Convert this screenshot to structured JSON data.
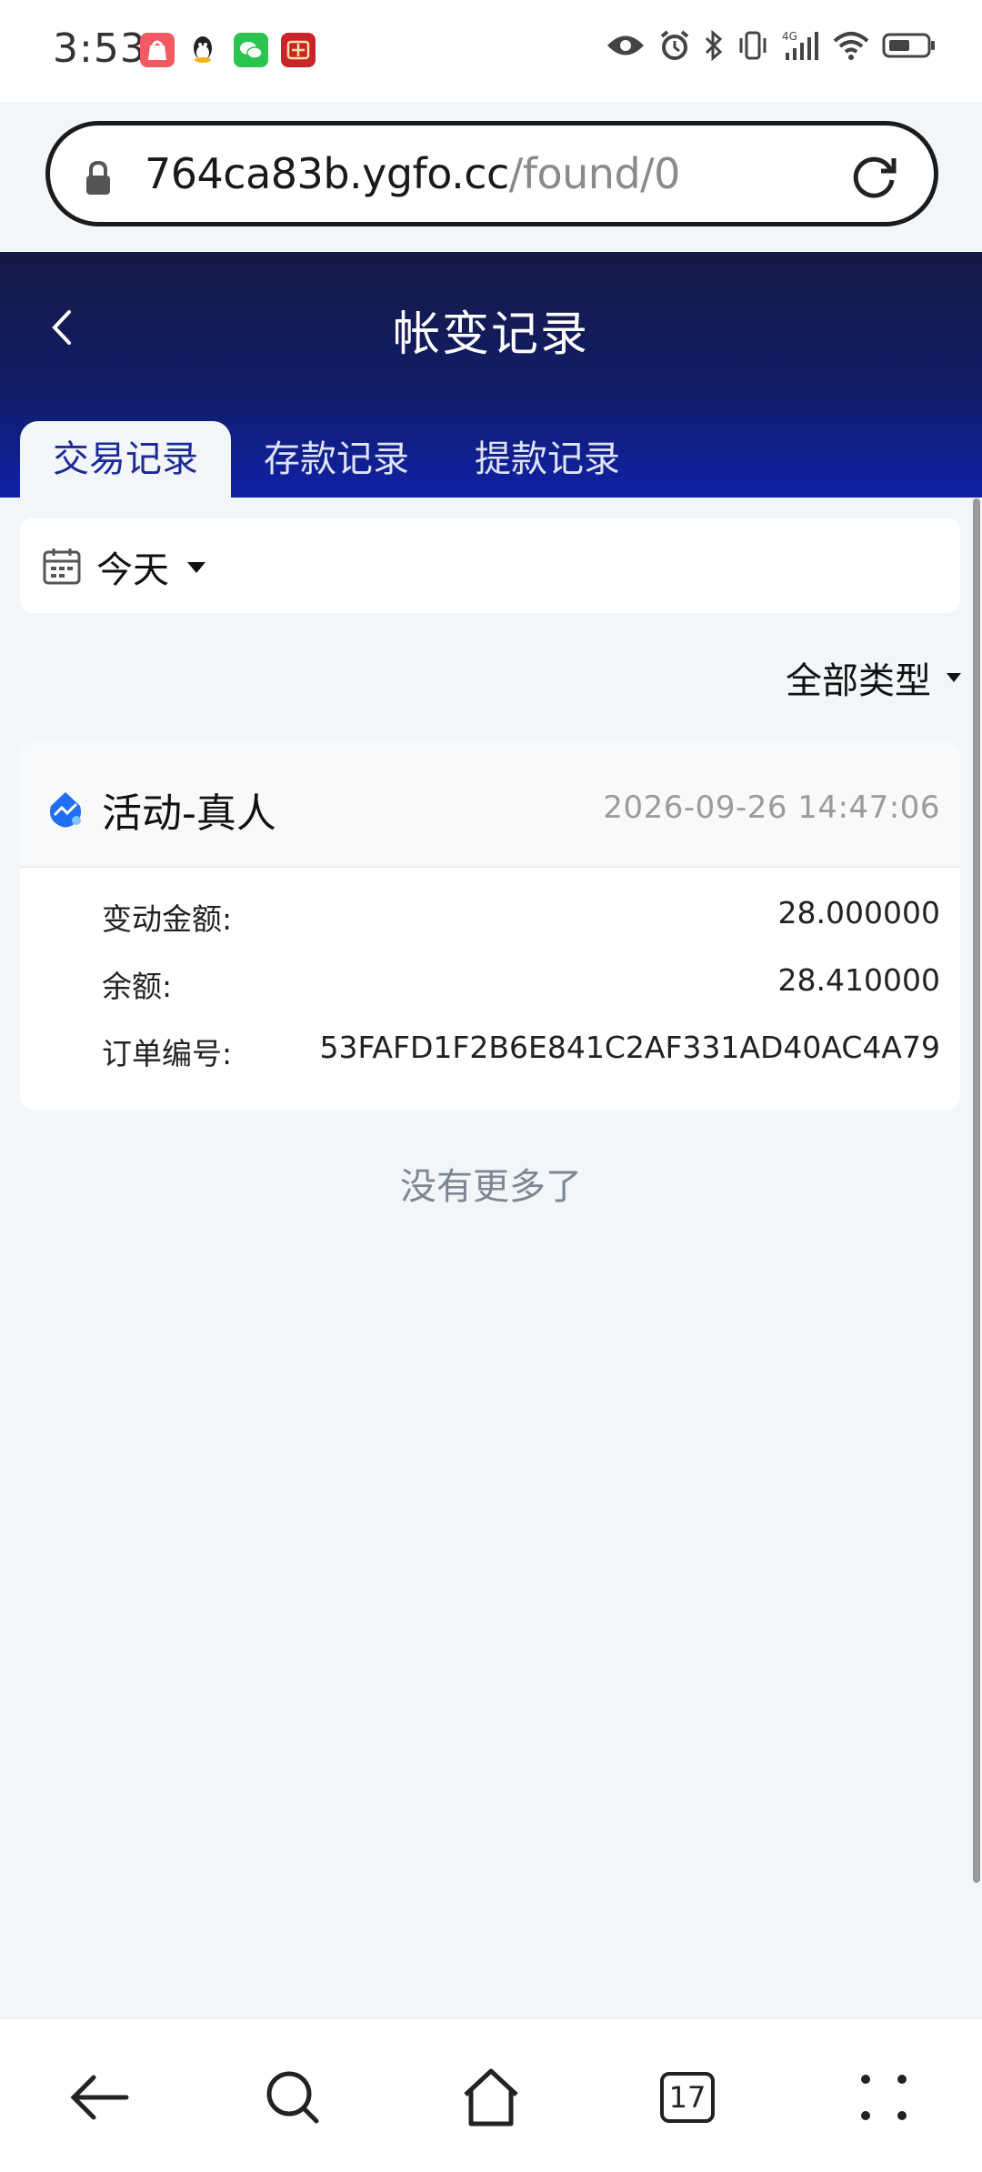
{
  "status_bar": {
    "time": "3:53",
    "right_icons": [
      "eye-icon",
      "alarm-icon",
      "bluetooth-icon",
      "vibrate-icon",
      "signal-4g-icon",
      "wifi-icon",
      "battery-icon"
    ],
    "notification_icons": [
      "shopping-app-icon",
      "qq-icon",
      "wechat-icon",
      "app-red-icon"
    ]
  },
  "url_bar": {
    "host": "764ca83b.ygfo.cc",
    "path": "/found/0"
  },
  "header": {
    "title": "帐变记录",
    "tabs": [
      {
        "label": "交易记录",
        "active": true
      },
      {
        "label": "存款记录",
        "active": false
      },
      {
        "label": "提款记录",
        "active": false
      }
    ]
  },
  "filters": {
    "date_label": "今天",
    "type_label": "全部类型"
  },
  "records": [
    {
      "title": "活动-真人",
      "time": "2026-09-26 14:47:06",
      "rows": [
        {
          "key": "变动金额:",
          "value": "28.000000"
        },
        {
          "key": "余额:",
          "value": "28.410000"
        },
        {
          "key": "订单编号:",
          "value": "53FAFD1F2B6E841C2AF331AD40AC4A79"
        }
      ]
    }
  ],
  "footer_text": "没有更多了",
  "bottom_nav": {
    "tab_count": "17"
  },
  "colors": {
    "header_dark": "#141a45",
    "header_blue": "#0f21a6",
    "active_tab_text": "#1c2a99",
    "page_bg": "#f3f6f8"
  }
}
